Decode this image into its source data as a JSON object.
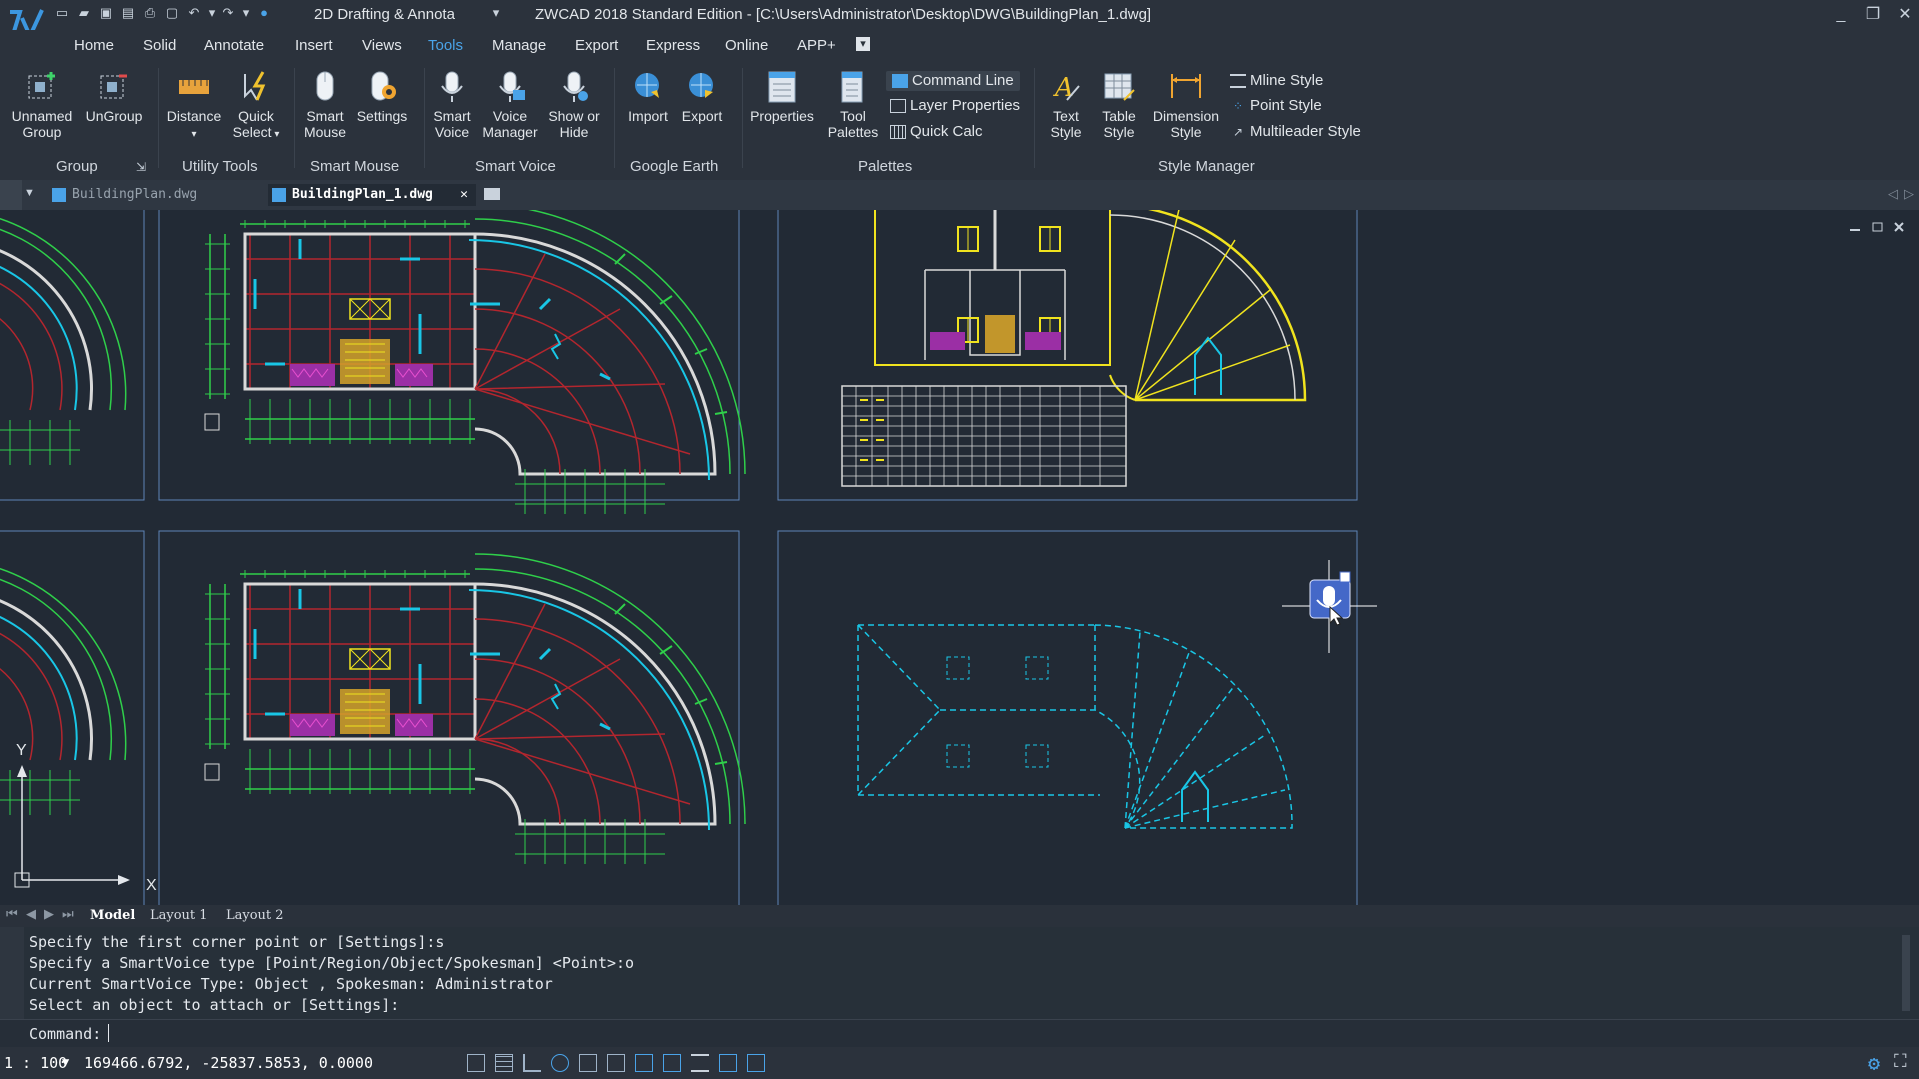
{
  "titlebar": {
    "workspace": "2D Drafting & Annota",
    "title": "ZWCAD 2018 Standard Edition - [C:\\Users\\Administrator\\Desktop\\DWG\\BuildingPlan_1.dwg]"
  },
  "menu": [
    "Home",
    "Solid",
    "Annotate",
    "Insert",
    "Views",
    "Tools",
    "Manage",
    "Export",
    "Express",
    "Online",
    "APP+"
  ],
  "ribbon": {
    "tools": {
      "unnamed_group": "Unnamed\nGroup",
      "ungroup": "UnGroup",
      "distance": "Distance",
      "quick_select": "Quick\nSelect",
      "smart_mouse": "Smart\nMouse",
      "settings": "Settings",
      "smart_voice": "Smart\nVoice",
      "voice_manager": "Voice\nManager",
      "show_or_hide": "Show or\nHide",
      "import": "Import",
      "export": "Export",
      "properties": "Properties",
      "tool_palettes": "Tool\nPalettes",
      "command_line": "Command Line",
      "layer_properties": "Layer Properties",
      "quick_calc": "Quick Calc",
      "text_style": "Text\nStyle",
      "table_style": "Table\nStyle",
      "dimension_style": "Dimension\nStyle",
      "mline_style": "Mline Style",
      "point_style": "Point Style",
      "multileader_style": "Multileader Style"
    },
    "groups": {
      "group": "Group",
      "utility_tools": "Utility Tools",
      "smart_mouse": "Smart Mouse",
      "smart_voice": "Smart Voice",
      "google_earth": "Google Earth",
      "palettes": "Palettes",
      "style_manager": "Style Manager"
    }
  },
  "doc_tabs": [
    {
      "label": "BuildingPlan.dwg",
      "active": false
    },
    {
      "label": "BuildingPlan_1.dwg",
      "active": true
    }
  ],
  "layout_tabs": [
    "Model",
    "Layout 1",
    "Layout 2"
  ],
  "command_history": [
    "Specify the first corner point or [Settings]:s",
    "Specify a SmartVoice type [Point/Region/Object/Spokesman] <Point>:o",
    "Current SmartVoice Type: Object , Spokesman: Administrator",
    "Select an object to attach or [Settings]:"
  ],
  "command_prompt": "Command:",
  "status": {
    "scale": "1 : 100",
    "coordinates": "169466.6792, -25837.5853, 0.0000"
  },
  "colors": {
    "background": "#222a35",
    "ui_panel": "#2b323c",
    "accent": "#4aa3e8",
    "wall": "#d9d9d9",
    "cyan": "#19c6e6",
    "green": "#2fcf4a",
    "red": "#b3262e",
    "yellow": "#f0e31e",
    "magenta": "#e84fd0"
  },
  "icons": [
    "app-logo-icon",
    "microphone-icon",
    "settings-gear-icon",
    "fullscreen-icon"
  ]
}
